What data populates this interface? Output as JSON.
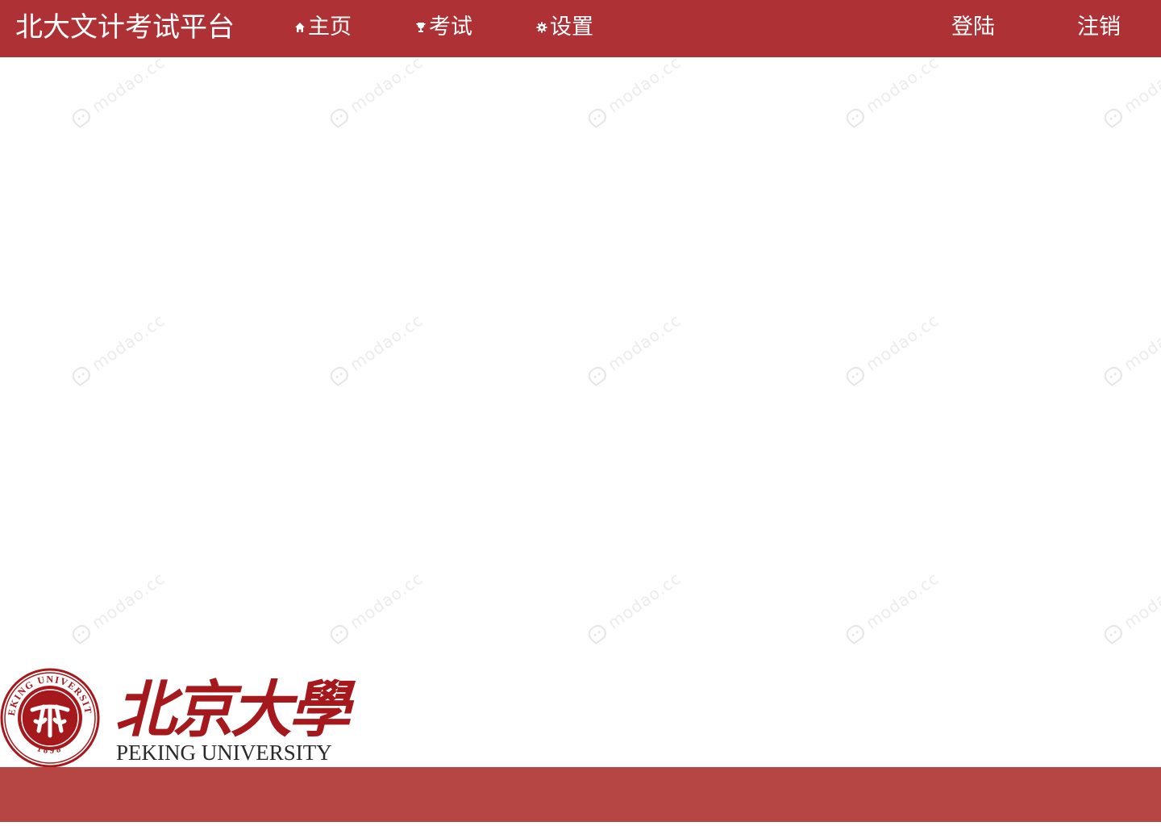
{
  "header": {
    "brand": "北大文计考试平台",
    "nav": [
      {
        "label": "主页",
        "icon": "home-icon"
      },
      {
        "label": "考试",
        "icon": "trophy-icon"
      },
      {
        "label": "设置",
        "icon": "gear-icon"
      }
    ],
    "auth": {
      "login_label": "登陆",
      "logout_label": "注销"
    }
  },
  "watermark": {
    "text": "modao.cc"
  },
  "logo": {
    "cn_name": "北京大學",
    "en_name": "PEKING UNIVERSITY",
    "seal_text": "PEKING UNIVERSITY",
    "seal_year": "1898"
  },
  "colors": {
    "header_bg": "#ae3135",
    "footer_bg": "#b54644",
    "logo_red": "#a5181c"
  }
}
